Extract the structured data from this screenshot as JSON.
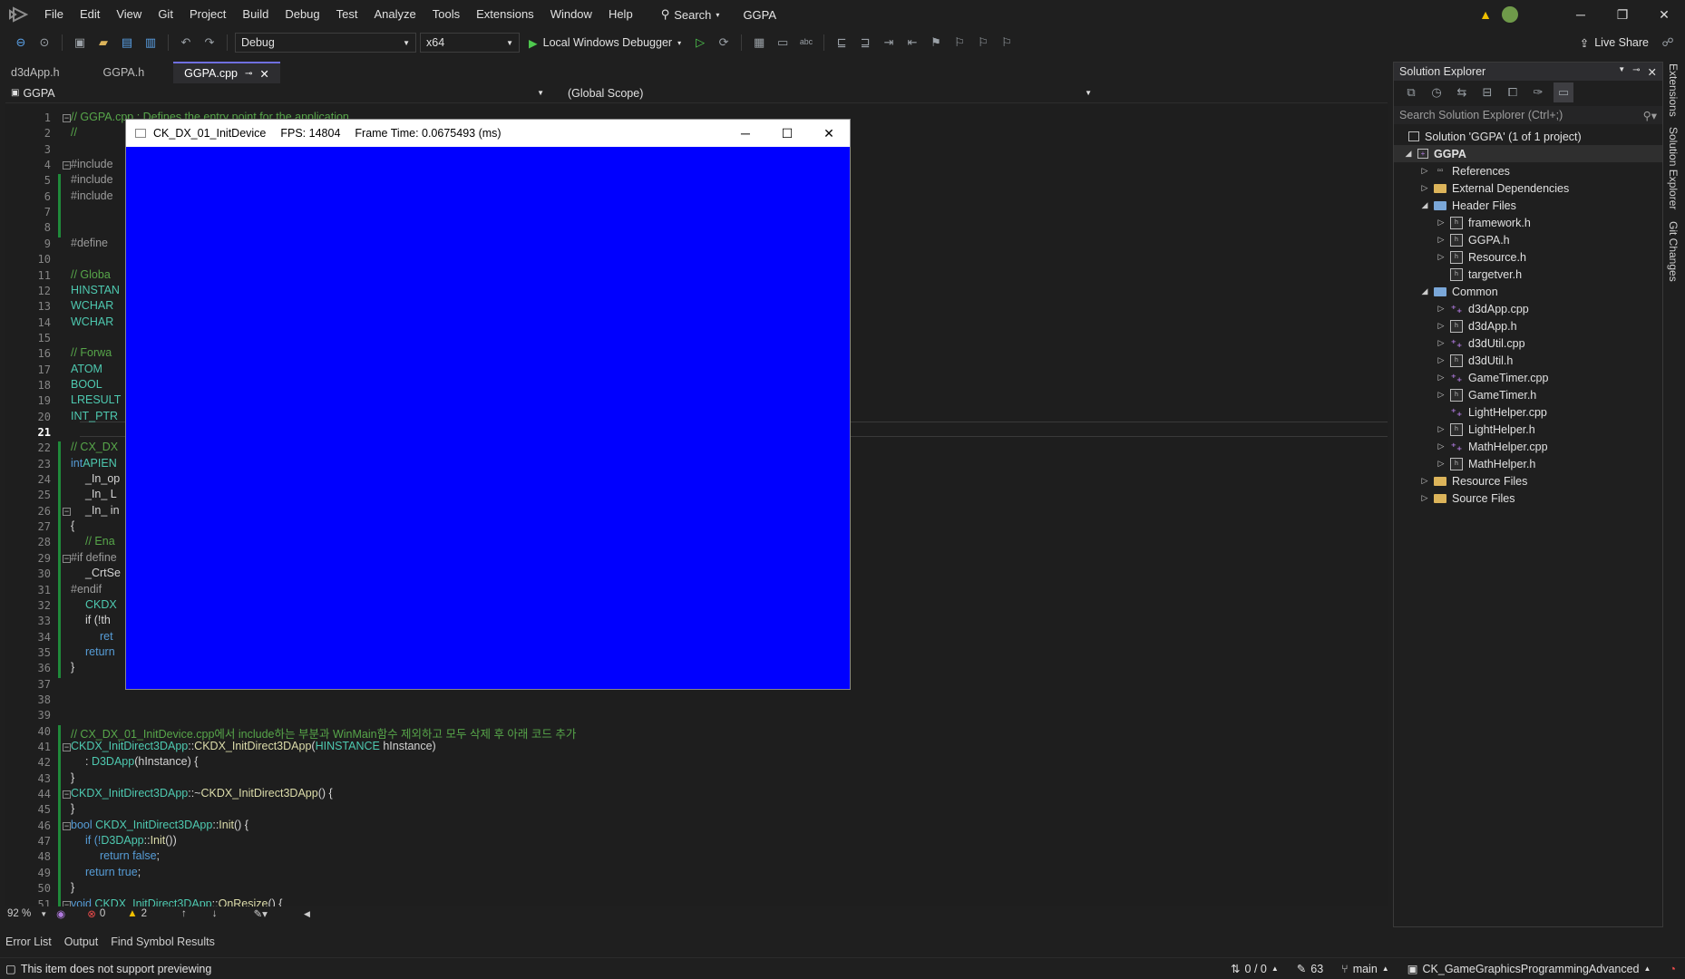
{
  "menu": {
    "items": [
      "File",
      "Edit",
      "View",
      "Git",
      "Project",
      "Build",
      "Debug",
      "Test",
      "Analyze",
      "Tools",
      "Extensions",
      "Window",
      "Help"
    ],
    "search_label": "Search",
    "project_name": "GGPA"
  },
  "toolbar": {
    "config": "Debug",
    "platform": "x64",
    "run_label": "Local Windows Debugger",
    "live_share": "Live Share"
  },
  "tabs": [
    {
      "label": "d3dApp.h"
    },
    {
      "label": "GGPA.h"
    },
    {
      "label": "GGPA.cpp"
    }
  ],
  "navbar": {
    "project": "GGPA",
    "scope": "(Global Scope)"
  },
  "line_numbers": [
    "1",
    "2",
    "3",
    "4",
    "5",
    "6",
    "7",
    "8",
    "9",
    "10",
    "11",
    "12",
    "13",
    "14",
    "15",
    "16",
    "17",
    "18",
    "19",
    "20",
    "21",
    "22",
    "23",
    "24",
    "25",
    "26",
    "27",
    "28",
    "29",
    "30",
    "31",
    "32",
    "33",
    "34",
    "35",
    "36",
    "37",
    "38",
    "39",
    "40",
    "41",
    "42",
    "43",
    "44",
    "45",
    "46",
    "47",
    "48",
    "49",
    "50",
    "51"
  ],
  "code": {
    "l1": "// GGPA.cpp : Defines the entry point for the application.",
    "l2": "//",
    "l4": "#include",
    "l5": "#include",
    "l6": "#include",
    "l9": "#define",
    "l11": "// Globa",
    "l12": "HINSTAN",
    "l13": "WCHAR",
    "l14": "WCHAR",
    "l16": "// Forwa",
    "l17": "ATOM",
    "l18": "BOOL",
    "l19": "LRESULT",
    "l20": "INT_PTR",
    "l22": "// CX_DX",
    "l23a": "int",
    "l23b": "APIEN",
    "l24": "_In_op",
    "l25": "_In_ L",
    "l26": "_In_ in",
    "l27": "{",
    "l28": "// Ena",
    "l29": "#if define",
    "l30": "_CrtSe",
    "l31": "#endif",
    "l32": "CKDX",
    "l33": "if (!th",
    "l34": "ret",
    "l35": "return",
    "l36": "}",
    "l40": "// CX_DX_01_InitDevice.cpp에서 include하는 부분과 WinMain함수 제외하고 모두 삭제 후 아래 코드 추가",
    "l41a": "CKDX_InitDirect3DApp",
    "l41b": "::",
    "l41c": "CKDX_InitDirect3DApp",
    "l41d": "(",
    "l41e": "HINSTANCE",
    "l41f": " hInstance)",
    "l42a": ": ",
    "l42b": "D3DApp",
    "l42c": "(hInstance) {",
    "l43": "}",
    "l44a": "CKDX_InitDirect3DApp",
    "l44b": "::~",
    "l44c": "CKDX_InitDirect3DApp",
    "l44d": "() {",
    "l45": "}",
    "l46a": "bool",
    "l46b": " CKDX_InitDirect3DApp",
    "l46c": "::",
    "l46d": "Init",
    "l46e": "() {",
    "l47a": "if (!",
    "l47b": "D3DApp",
    "l47c": "::",
    "l47d": "Init",
    "l47e": "())",
    "l48a": "return ",
    "l48b": "false",
    "l48c": ";",
    "l49a": "return ",
    "l49b": "true",
    "l49c": ";",
    "l50": "}",
    "l51a": "void",
    "l51b": " CKDX_InitDirect3DApp",
    "l51c": "::",
    "l51d": "OnResize",
    "l51e": "() {"
  },
  "editor_status": {
    "zoom": "92 %",
    "errors": "0",
    "warnings": "2"
  },
  "bottom_tabs": [
    "Error List",
    "Output",
    "Find Symbol Results"
  ],
  "status": {
    "message": "This item does not support previewing",
    "changes": "0 / 0",
    "pencil": "63",
    "branch": "main",
    "repo": "CK_GameGraphicsProgrammingAdvanced"
  },
  "solution_explorer": {
    "title": "Solution Explorer",
    "search_placeholder": "Search Solution Explorer (Ctrl+;)",
    "solution": "Solution 'GGPA'  (1 of 1 project)",
    "project": "GGPA",
    "rows": [
      {
        "label": "References",
        "indent": 1,
        "chev": "right",
        "icon": "ref"
      },
      {
        "label": "External Dependencies",
        "indent": 1,
        "chev": "right",
        "icon": "folder"
      },
      {
        "label": "Header Files",
        "indent": 1,
        "chev": "down",
        "icon": "folder-open"
      },
      {
        "label": "framework.h",
        "indent": 2,
        "chev": "right",
        "icon": "h"
      },
      {
        "label": "GGPA.h",
        "indent": 2,
        "chev": "right",
        "icon": "h"
      },
      {
        "label": "Resource.h",
        "indent": 2,
        "chev": "right",
        "icon": "h"
      },
      {
        "label": "targetver.h",
        "indent": 2,
        "chev": "none",
        "icon": "h"
      },
      {
        "label": "Common",
        "indent": 1,
        "chev": "down",
        "icon": "folder-open"
      },
      {
        "label": "d3dApp.cpp",
        "indent": 2,
        "chev": "right",
        "icon": "cpp"
      },
      {
        "label": "d3dApp.h",
        "indent": 2,
        "chev": "right",
        "icon": "h"
      },
      {
        "label": "d3dUtil.cpp",
        "indent": 2,
        "chev": "right",
        "icon": "cpp"
      },
      {
        "label": "d3dUtil.h",
        "indent": 2,
        "chev": "right",
        "icon": "h"
      },
      {
        "label": "GameTimer.cpp",
        "indent": 2,
        "chev": "right",
        "icon": "cpp"
      },
      {
        "label": "GameTimer.h",
        "indent": 2,
        "chev": "right",
        "icon": "h"
      },
      {
        "label": "LightHelper.cpp",
        "indent": 2,
        "chev": "none",
        "icon": "cpp"
      },
      {
        "label": "LightHelper.h",
        "indent": 2,
        "chev": "right",
        "icon": "h"
      },
      {
        "label": "MathHelper.cpp",
        "indent": 2,
        "chev": "right",
        "icon": "cpp"
      },
      {
        "label": "MathHelper.h",
        "indent": 2,
        "chev": "right",
        "icon": "h"
      },
      {
        "label": "Resource Files",
        "indent": 1,
        "chev": "right",
        "icon": "folder"
      },
      {
        "label": "Source Files",
        "indent": 1,
        "chev": "right",
        "icon": "folder"
      }
    ]
  },
  "side_strip": [
    "Extensions",
    "Solution Explorer",
    "Git Changes"
  ],
  "dx_window": {
    "title": "CK_DX_01_InitDevice",
    "fps": "FPS: 14804",
    "frame_time": "Frame Time: 0.0675493 (ms)",
    "fill_color": "#0000ff"
  }
}
